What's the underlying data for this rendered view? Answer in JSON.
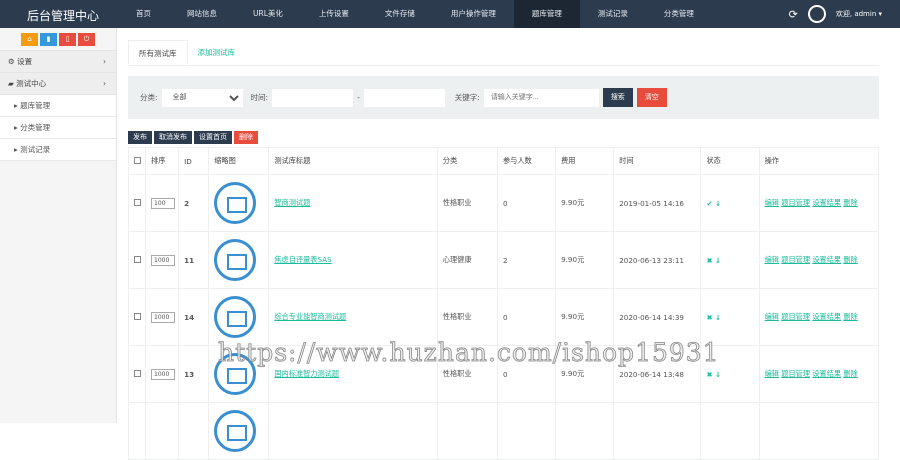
{
  "header": {
    "title": "后台管理中心",
    "nav": [
      "首页",
      "网站信息",
      "URL美化",
      "上传设置",
      "文件存储",
      "用户操作管理",
      "题库管理",
      "测试记录",
      "分类管理"
    ],
    "active": 6,
    "welcome": "欢迎, admin ▾"
  },
  "sidebar": {
    "menus": [
      {
        "label": "设置"
      },
      {
        "label": "测试中心"
      }
    ],
    "subs": [
      "题库管理",
      "分类管理",
      "测试记录"
    ]
  },
  "tabs": [
    "所有测试库",
    "添加测试库"
  ],
  "filter": {
    "category_label": "分类:",
    "category_value": "全部",
    "time_label": "时间:",
    "dash": "-",
    "keyword_label": "关键字:",
    "keyword_placeholder": "请输入关键字...",
    "search": "搜索",
    "clear": "清空"
  },
  "actions": [
    "发布",
    "取消发布",
    "设置首页",
    "删除"
  ],
  "columns": [
    "排序",
    "ID",
    "缩略图",
    "测试库标题",
    "分类",
    "参与人数",
    "费用",
    "时间",
    "状态",
    "操作"
  ],
  "rows": [
    {
      "sort": "100",
      "id": "2",
      "title": "智商测试题",
      "category": "性格职业",
      "count": "0",
      "fee": "9.90元",
      "time": "2019-01-05 14:16",
      "status": "✔"
    },
    {
      "sort": "1000",
      "id": "11",
      "title": "焦虑自评量表SAS",
      "category": "心理健康",
      "count": "2",
      "fee": "9.90元",
      "time": "2020-06-13 23:11",
      "status": "✖"
    },
    {
      "sort": "1000",
      "id": "14",
      "title": "综合专业能智商测试题",
      "category": "性格职业",
      "count": "0",
      "fee": "9.90元",
      "time": "2020-06-14 14:39",
      "status": "✖"
    },
    {
      "sort": "1000",
      "id": "13",
      "title": "国内标准智力测试题",
      "category": "性格职业",
      "count": "0",
      "fee": "9.90元",
      "time": "2020-06-14 13:48",
      "status": "✖"
    }
  ],
  "row_ops": [
    "编辑",
    "题目管理",
    "设置结果",
    "删除"
  ],
  "watermark": "https://www.huzhan.com/ishop15931"
}
